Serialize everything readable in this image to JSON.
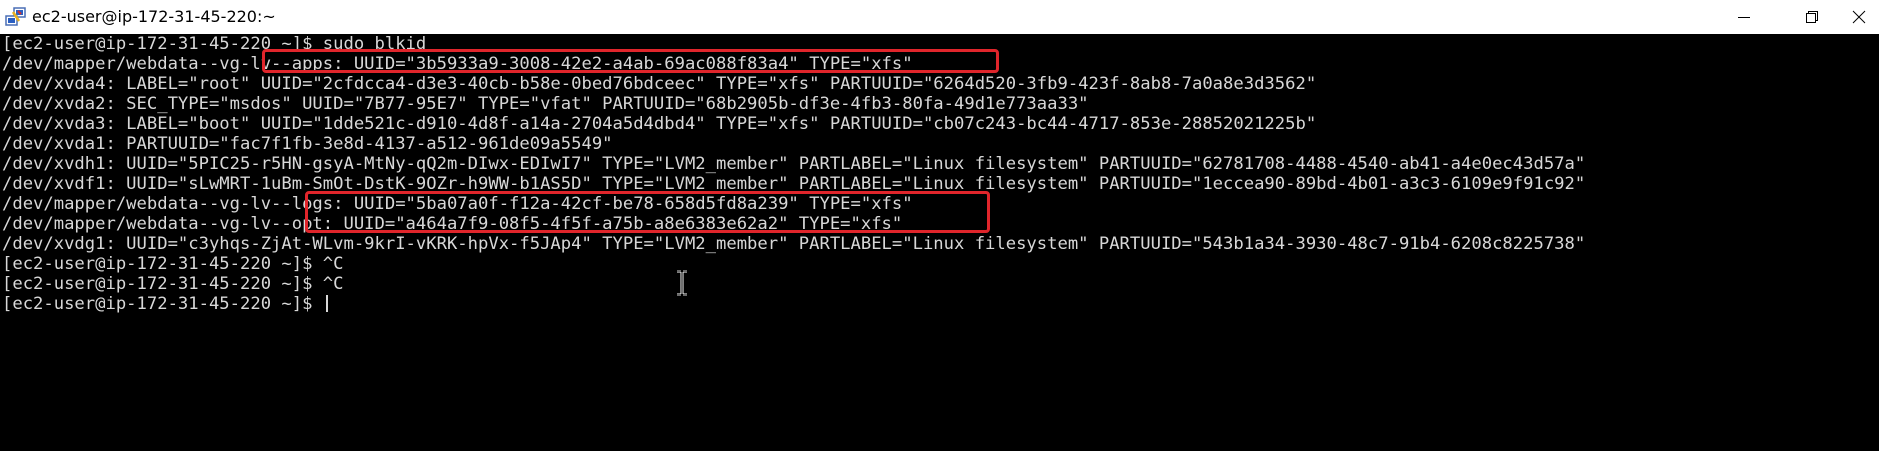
{
  "window": {
    "title": "ec2-user@ip-172-31-45-220:~",
    "icon": "putty-icon",
    "controls": [
      "minimize-icon",
      "maximize-icon",
      "close-icon"
    ]
  },
  "terminal": {
    "colors": {
      "background": "#000000",
      "foreground": "#d8d8d8",
      "annotation": "#e0252b"
    },
    "lines": [
      "[ec2-user@ip-172-31-45-220 ~]$ sudo blkid",
      "/dev/mapper/webdata--vg-lv--apps: UUID=\"3b5933a9-3008-42e2-a4ab-69ac088f83a4\" TYPE=\"xfs\"",
      "/dev/xvda4: LABEL=\"root\" UUID=\"2cfdcca4-d3e3-40cb-b58e-0bed76bdceec\" TYPE=\"xfs\" PARTUUID=\"6264d520-3fb9-423f-8ab8-7a0a8e3d3562\"",
      "/dev/xvda2: SEC_TYPE=\"msdos\" UUID=\"7B77-95E7\" TYPE=\"vfat\" PARTUUID=\"68b2905b-df3e-4fb3-80fa-49d1e773aa33\"",
      "/dev/xvda3: LABEL=\"boot\" UUID=\"1dde521c-d910-4d8f-a14a-2704a5d4dbd4\" TYPE=\"xfs\" PARTUUID=\"cb07c243-bc44-4717-853e-28852021225b\"",
      "/dev/xvda1: PARTUUID=\"fac7f1fb-3e8d-4137-a512-961de09a5549\"",
      "/dev/xvdh1: UUID=\"5PIC25-r5HN-gsyA-MtNy-qQ2m-DIwx-EDIwI7\" TYPE=\"LVM2_member\" PARTLABEL=\"Linux filesystem\" PARTUUID=\"62781708-4488-4540-ab41-a4e0ec43d57a\"",
      "/dev/xvdf1: UUID=\"sLwMRT-1uBm-SmOt-DstK-9OZr-h9WW-b1AS5D\" TYPE=\"LVM2_member\" PARTLABEL=\"Linux filesystem\" PARTUUID=\"1eccea90-89bd-4b01-a3c3-6109e9f91c92\"",
      "/dev/mapper/webdata--vg-lv--logs: UUID=\"5ba07a0f-f12a-42cf-be78-658d5fd8a239\" TYPE=\"xfs\"",
      "/dev/mapper/webdata--vg-lv--opt: UUID=\"a464a7f9-08f5-4f5f-a75b-a8e6383e62a2\" TYPE=\"xfs\"",
      "/dev/xvdg1: UUID=\"c3yhqs-ZjAt-WLvm-9krI-vKRK-hpVx-f5JAp4\" TYPE=\"LVM2_member\" PARTLABEL=\"Linux filesystem\" PARTUUID=\"543b1a34-3930-48c7-91b4-6208c8225738\"",
      "[ec2-user@ip-172-31-45-220 ~]$ ^C",
      "[ec2-user@ip-172-31-45-220 ~]$ ^C",
      "[ec2-user@ip-172-31-45-220 ~]$ "
    ]
  }
}
